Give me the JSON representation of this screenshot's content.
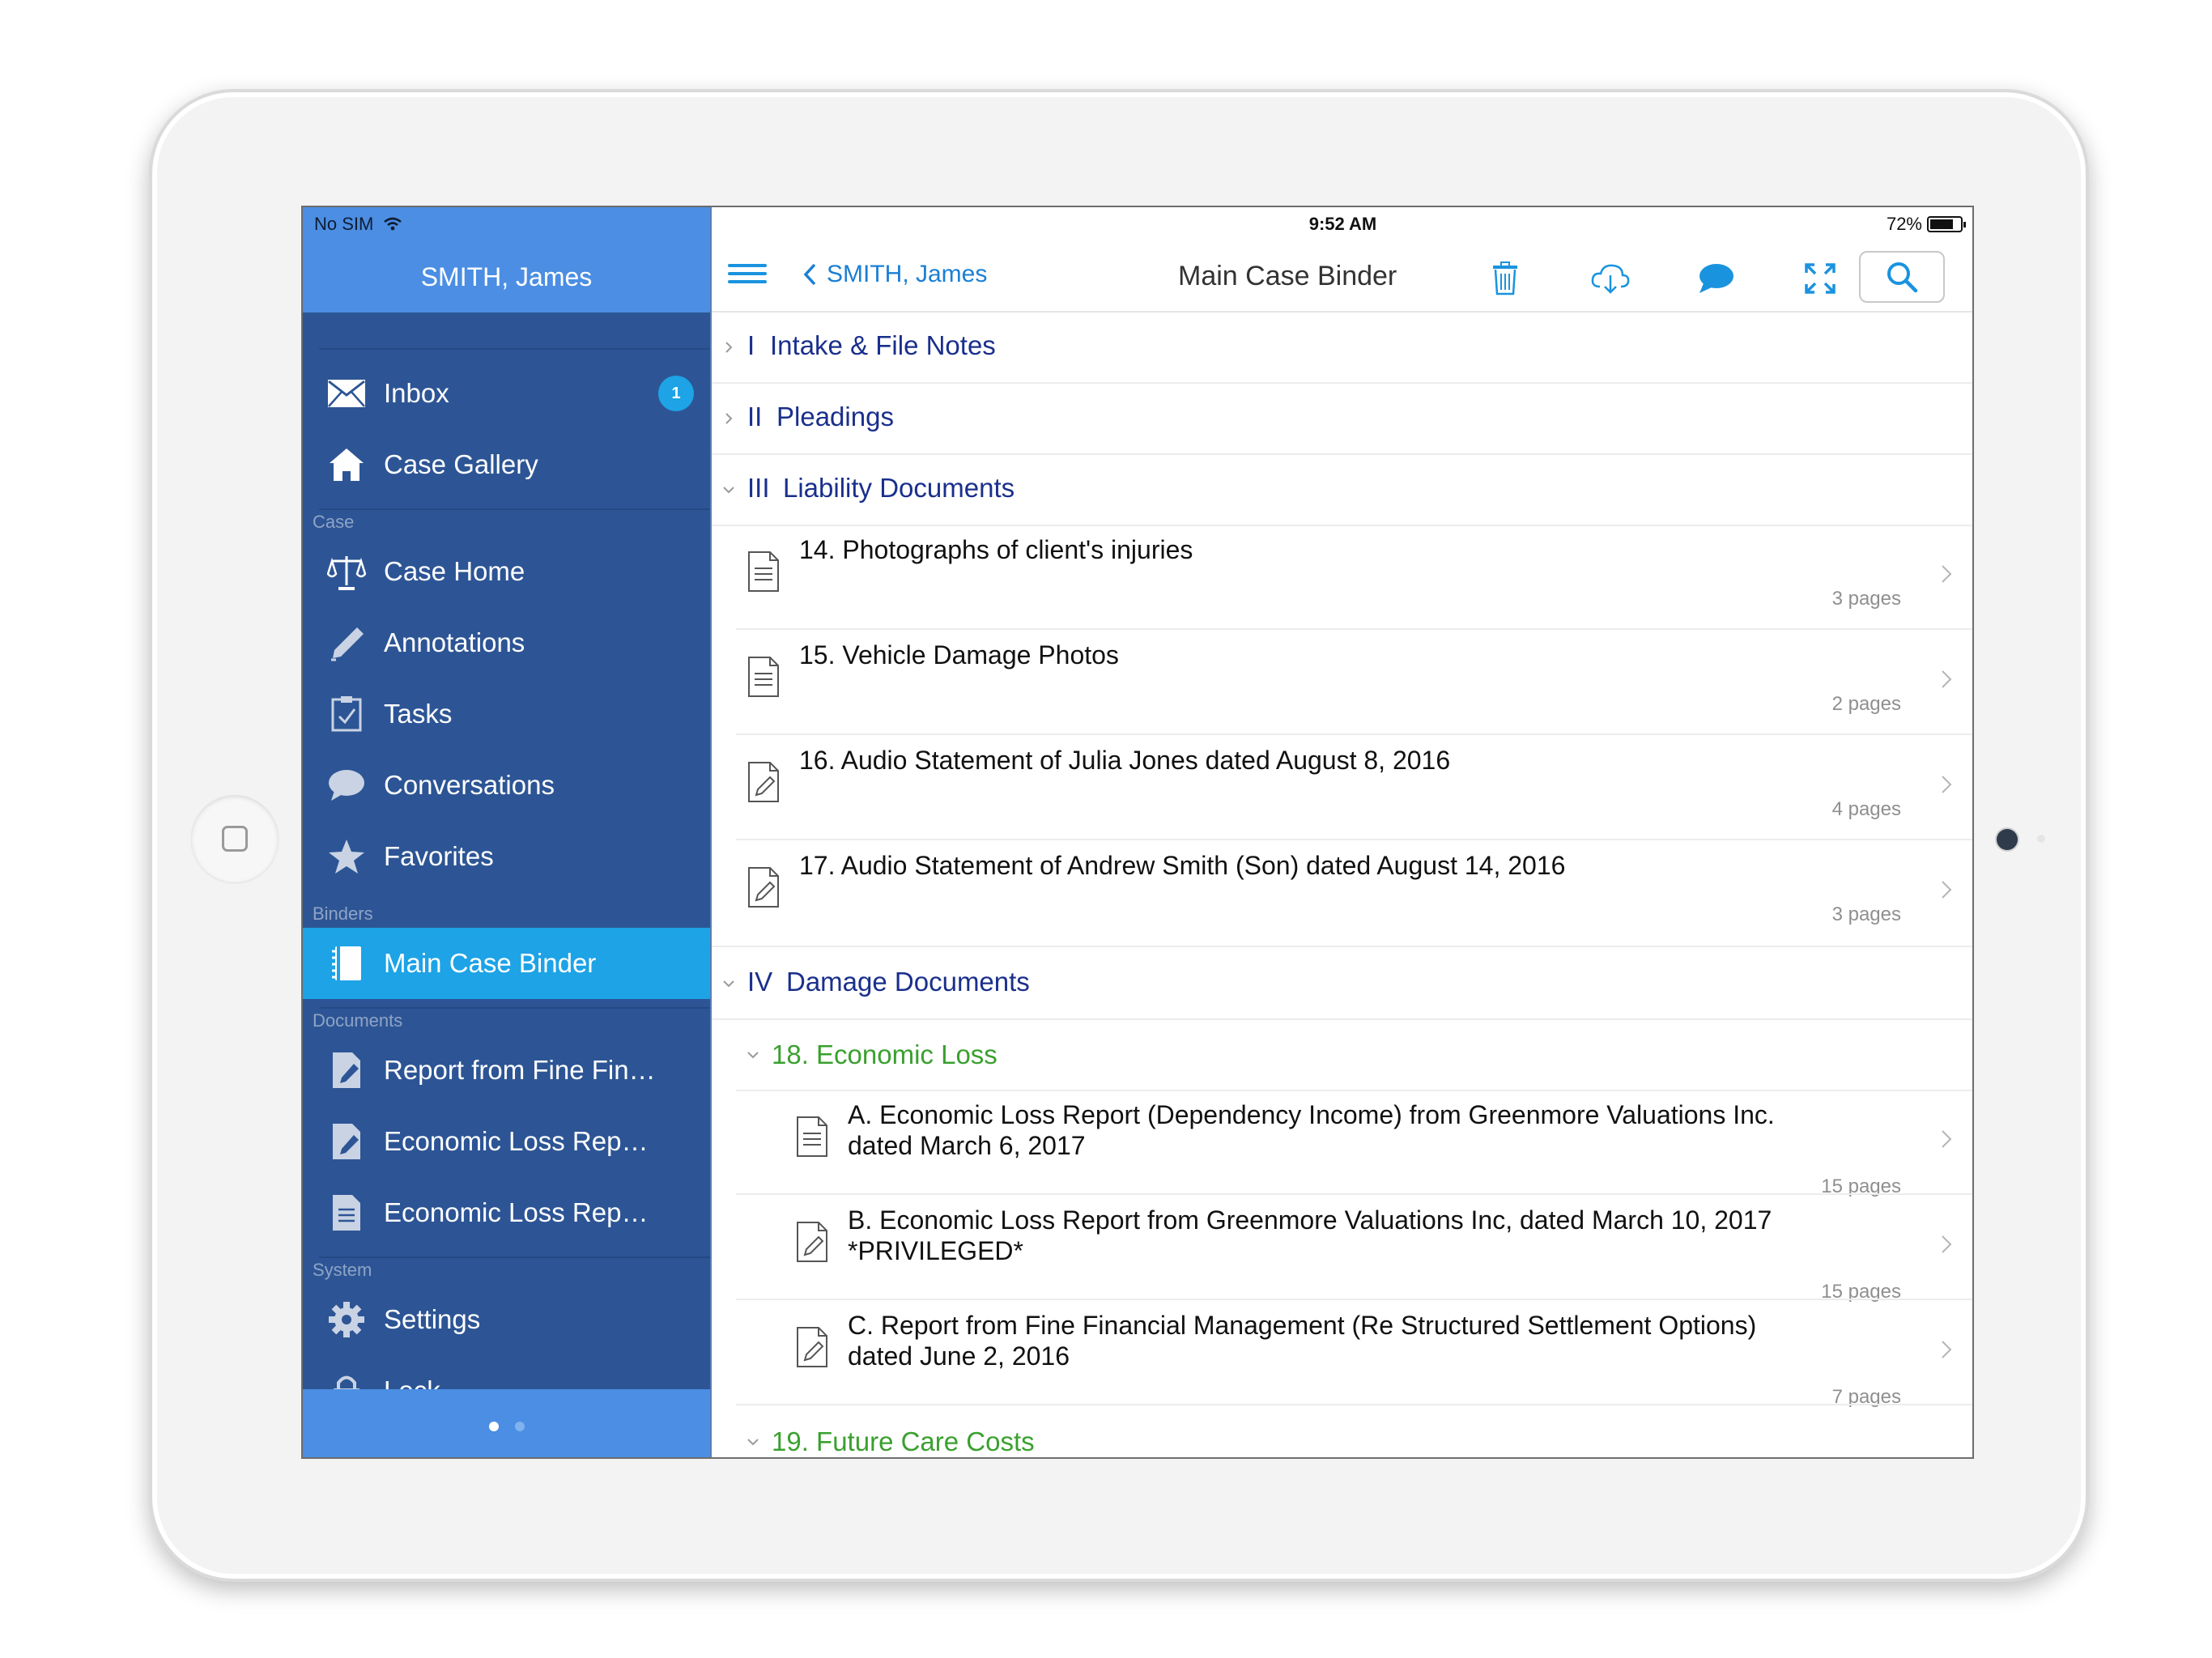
{
  "status_bar": {
    "carrier": "No SIM",
    "time": "9:52 AM",
    "battery": "72%",
    "battery_level": 0.72
  },
  "sidebar": {
    "title": "SMITH, James",
    "sections": {
      "case": "Case",
      "binders": "Binders",
      "documents": "Documents",
      "system": "System"
    },
    "items": [
      {
        "label": "Inbox",
        "icon": "envelope-icon",
        "badge": "1"
      },
      {
        "label": "Case Gallery",
        "icon": "house-icon"
      },
      {
        "label": "Case Home",
        "icon": "scales-icon"
      },
      {
        "label": "Annotations",
        "icon": "pencil-icon"
      },
      {
        "label": "Tasks",
        "icon": "task-clipboard-icon"
      },
      {
        "label": "Conversations",
        "icon": "chat-bubble-icon"
      },
      {
        "label": "Favorites",
        "icon": "star-icon"
      },
      {
        "label": "Main Case Binder",
        "icon": "binder-icon",
        "active": true
      },
      {
        "label": "Report from Fine Fin…",
        "icon": "document-edit-icon"
      },
      {
        "label": "Economic Loss Rep…",
        "icon": "document-edit-icon"
      },
      {
        "label": "Economic Loss Rep…",
        "icon": "document-icon"
      },
      {
        "label": "Settings",
        "icon": "gear-icon"
      },
      {
        "label": "Lock",
        "icon": "lock-icon"
      }
    ],
    "page_indicator": {
      "pages": 2,
      "current": 1
    }
  },
  "toolbar": {
    "back_label": "SMITH, James",
    "title": "Main Case Binder",
    "icons": [
      "menu-icon",
      "trash-icon",
      "cloud-download-icon",
      "chat-bubble-icon",
      "fullscreen-icon",
      "search-icon"
    ],
    "accent": "#1a93df"
  },
  "binder": {
    "sections": [
      {
        "num": "I",
        "title": "Intake & File Notes",
        "expanded": false
      },
      {
        "num": "II",
        "title": "Pleadings",
        "expanded": false
      },
      {
        "num": "III",
        "title": "Liability Documents",
        "expanded": true
      },
      {
        "num": "IV",
        "title": "Damage Documents",
        "expanded": true
      }
    ],
    "liability_docs": [
      {
        "title": "14. Photographs of client's injuries",
        "pages": "3 pages",
        "icon": "document-icon"
      },
      {
        "title": "15. Vehicle Damage Photos",
        "pages": "2 pages",
        "icon": "document-icon"
      },
      {
        "title": "16. Audio Statement of Julia Jones dated August 8, 2016",
        "pages": "4 pages",
        "icon": "document-edit-icon"
      },
      {
        "title": "17. Audio Statement of Andrew Smith (Son) dated August 14, 2016",
        "pages": "3 pages",
        "icon": "document-edit-icon"
      }
    ],
    "subsections": [
      {
        "title": "18. Economic Loss"
      },
      {
        "title": "19. Future Care Costs"
      }
    ],
    "economic_docs": [
      {
        "line1": "A. Economic Loss Report (Dependency Income) from Greenmore Valuations Inc.",
        "line2": "dated March 6, 2017",
        "pages": "15 pages",
        "icon": "document-icon"
      },
      {
        "line1": "B. Economic Loss Report from Greenmore Valuations Inc, dated March 10, 2017",
        "line2": "*PRIVILEGED*",
        "pages": "15 pages",
        "icon": "document-edit-icon"
      },
      {
        "line1": "C. Report from Fine Financial Management (Re Structured Settlement Options)",
        "line2": "dated June 2, 2016",
        "pages": "7 pages",
        "icon": "document-edit-icon"
      }
    ],
    "colors": {
      "section": "#1a2f8c",
      "subsection": "#3aa02f",
      "active_sidebar": "#1da3e6"
    }
  }
}
